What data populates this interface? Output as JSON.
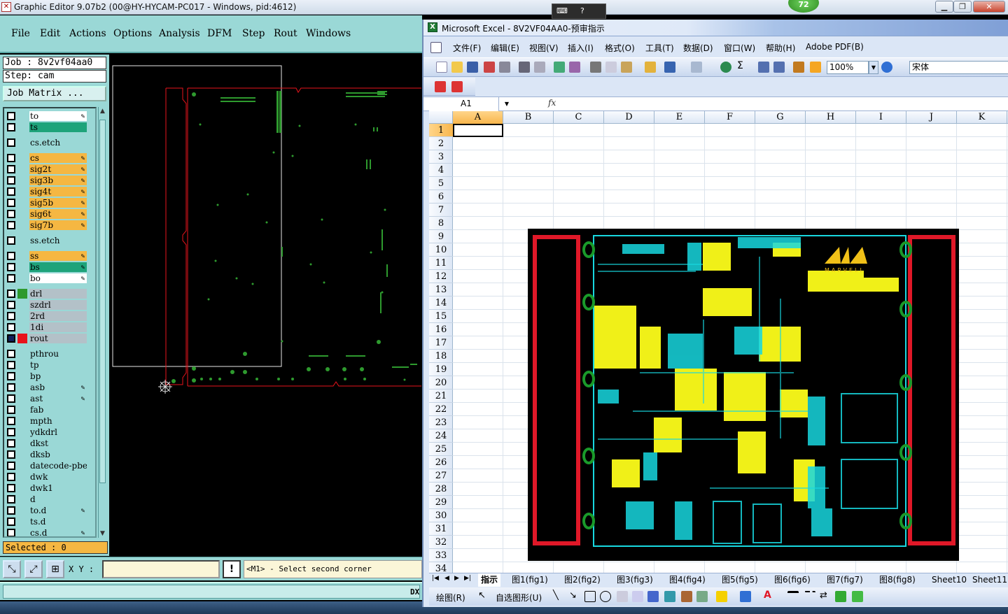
{
  "genesis": {
    "title": "Graphic Editor 9.07b2 (00@HY-HYCAM-PC017 - Windows, pid:4612)",
    "tray_badge": "72",
    "menu": [
      "File",
      "Edit",
      "Actions",
      "Options",
      "Analysis",
      "DFM",
      "Step",
      "Rout",
      "Windows"
    ],
    "job_label": "Job : 8v2vf04aa0",
    "step_label": "Step: cam",
    "job_matrix_label": "Job Matrix ...",
    "layers": [
      {
        "name": "to",
        "bg": "#ffffff",
        "mark": "",
        "pen": true,
        "group": 0
      },
      {
        "name": "ts",
        "bg": "#1ea37a",
        "mark": "",
        "pen": false,
        "group": 0
      },
      {
        "name": "cs.etch",
        "bg": "#9ad8d6",
        "mark": "",
        "pen": false,
        "group": 1
      },
      {
        "name": "cs",
        "bg": "#f5b742",
        "mark": "",
        "pen": true,
        "group": 2
      },
      {
        "name": "sig2t",
        "bg": "#f5b742",
        "mark": "",
        "pen": true,
        "group": 2
      },
      {
        "name": "sig3b",
        "bg": "#f5b742",
        "mark": "",
        "pen": true,
        "group": 2
      },
      {
        "name": "sig4t",
        "bg": "#f5b742",
        "mark": "",
        "pen": true,
        "group": 2
      },
      {
        "name": "sig5b",
        "bg": "#f5b742",
        "mark": "",
        "pen": true,
        "group": 2
      },
      {
        "name": "sig6t",
        "bg": "#f5b742",
        "mark": "",
        "pen": true,
        "group": 2
      },
      {
        "name": "sig7b",
        "bg": "#f5b742",
        "mark": "",
        "pen": true,
        "group": 2
      },
      {
        "name": "ss.etch",
        "bg": "#9ad8d6",
        "mark": "",
        "pen": false,
        "group": 3
      },
      {
        "name": "ss",
        "bg": "#f5b742",
        "mark": "",
        "pen": true,
        "group": 4
      },
      {
        "name": "bs",
        "bg": "#1ea37a",
        "mark": "",
        "pen": true,
        "group": 4
      },
      {
        "name": "bo",
        "bg": "#ffffff",
        "mark": "",
        "pen": true,
        "group": 4
      },
      {
        "name": "drl",
        "bg": "#b3c1c8",
        "mark": "#2e9a2e",
        "pen": false,
        "group": 5
      },
      {
        "name": "szdrl",
        "bg": "#b3c1c8",
        "mark": "",
        "pen": false,
        "group": 5
      },
      {
        "name": "2rd",
        "bg": "#b3c1c8",
        "mark": "",
        "pen": false,
        "group": 5
      },
      {
        "name": "1di",
        "bg": "#b3c1c8",
        "mark": "",
        "pen": false,
        "group": 5
      },
      {
        "name": "rout",
        "bg": "#b3c1c8",
        "mark": "#e8131b",
        "pen": false,
        "group": 5,
        "selected": true
      },
      {
        "name": "pthrou",
        "bg": "#9ad8d6",
        "mark": "",
        "pen": false,
        "group": 6
      },
      {
        "name": "tp",
        "bg": "#9ad8d6",
        "mark": "",
        "pen": false,
        "group": 6
      },
      {
        "name": "bp",
        "bg": "#9ad8d6",
        "mark": "",
        "pen": false,
        "group": 6
      },
      {
        "name": "asb",
        "bg": "#9ad8d6",
        "mark": "",
        "pen": true,
        "group": 6
      },
      {
        "name": "ast",
        "bg": "#9ad8d6",
        "mark": "",
        "pen": true,
        "group": 6
      },
      {
        "name": "fab",
        "bg": "#9ad8d6",
        "mark": "",
        "pen": false,
        "group": 6
      },
      {
        "name": "mpth",
        "bg": "#9ad8d6",
        "mark": "",
        "pen": false,
        "group": 6
      },
      {
        "name": "ydkdrl",
        "bg": "#9ad8d6",
        "mark": "",
        "pen": false,
        "group": 6
      },
      {
        "name": "dkst",
        "bg": "#9ad8d6",
        "mark": "",
        "pen": false,
        "group": 6
      },
      {
        "name": "dksb",
        "bg": "#9ad8d6",
        "mark": "",
        "pen": false,
        "group": 6
      },
      {
        "name": "datecode-pbe",
        "bg": "#9ad8d6",
        "mark": "",
        "pen": false,
        "group": 6
      },
      {
        "name": "dwk",
        "bg": "#9ad8d6",
        "mark": "",
        "pen": false,
        "group": 6
      },
      {
        "name": "dwk1",
        "bg": "#9ad8d6",
        "mark": "",
        "pen": false,
        "group": 6
      },
      {
        "name": "d",
        "bg": "#9ad8d6",
        "mark": "",
        "pen": false,
        "group": 6
      },
      {
        "name": "to.d",
        "bg": "#9ad8d6",
        "mark": "",
        "pen": true,
        "group": 6
      },
      {
        "name": "ts.d",
        "bg": "#9ad8d6",
        "mark": "",
        "pen": false,
        "group": 6
      },
      {
        "name": "cs.d",
        "bg": "#9ad8d6",
        "mark": "",
        "pen": true,
        "group": 6
      }
    ],
    "selected_label": "Selected : 0",
    "xy_label": "X Y :",
    "xy_value": "",
    "prompt": "<M1> - Select second corner",
    "dx_label": "DX"
  },
  "excel": {
    "title": "Microsoft Excel - 8V2VF04AA0-预审指示",
    "menu": [
      "文件(F)",
      "编辑(E)",
      "视图(V)",
      "插入(I)",
      "格式(O)",
      "工具(T)",
      "数据(D)",
      "窗口(W)",
      "帮助(H)",
      "Adobe PDF(B)"
    ],
    "zoom": "100%",
    "font": "宋体",
    "namebox": "A1",
    "fx": "fx",
    "columns": [
      "A",
      "B",
      "C",
      "D",
      "E",
      "F",
      "G",
      "H",
      "I",
      "J",
      "K"
    ],
    "rows": [
      "1",
      "2",
      "3",
      "4",
      "5",
      "6",
      "7",
      "8",
      "9",
      "10",
      "11",
      "12",
      "13",
      "14",
      "15",
      "16",
      "17",
      "18",
      "19",
      "20",
      "21",
      "22",
      "23",
      "24",
      "25",
      "26",
      "27",
      "28",
      "29",
      "30",
      "31",
      "32",
      "33",
      "34"
    ],
    "active_col": "A",
    "active_row": "1",
    "sheet_tabs": [
      "指示",
      "图1(fig1)",
      "图2(fig2)",
      "图3(fig3)",
      "图4(fig4)",
      "图5(fig5)",
      "图6(fig6)",
      "图7(fig7)",
      "图8(fig8)",
      "Sheet10",
      "Sheet11"
    ],
    "active_sheet": "指示",
    "draw_label": "绘图(R)",
    "autoshape_label": "自选图形(U)",
    "pcb_logo_text": "MARVELL"
  },
  "colors": {
    "genesis_panel": "#9ad8d6",
    "profile_red": "#e8131b",
    "pad_green": "#2e9a2e",
    "pcb_cyan": "#18d8e0",
    "pcb_yellow": "#f0f018",
    "pcb_red": "#e01828",
    "excel_chrome": "#dbe6f6"
  }
}
